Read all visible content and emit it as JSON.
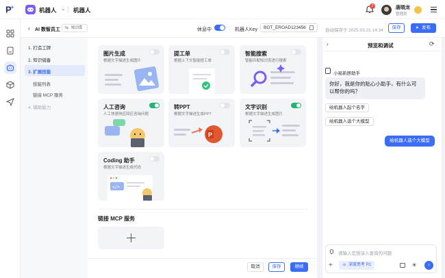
{
  "brand": {
    "logo_text": "P",
    "logo_sup": "+"
  },
  "header": {
    "robot_name": "机器人",
    "robot_name_secondary": "机器人",
    "notification_count": "2",
    "user_name": "唐晓龙",
    "user_role": "管理员"
  },
  "subheader": {
    "back_label": "AI 数智员工",
    "kb_label": "知识库",
    "rest_label": "休息中",
    "key_label": "机器人Key",
    "key_value": "BOT_EROAD123456",
    "autosave": "自动保存于 2025.03.21 14:34",
    "save_label": "保存",
    "publish_label": "发布"
  },
  "steps": [
    {
      "label": "1. 打造工牌"
    },
    {
      "label": "2. 知识储备"
    },
    {
      "label": "3. 扩展技能"
    },
    {
      "label": "技能列表"
    },
    {
      "label": "链接 MCP 服务"
    },
    {
      "label": "4. 辅助能力"
    }
  ],
  "skills": [
    {
      "title": "图片生成",
      "desc": "根据文字描述生成图片",
      "enabled": false
    },
    {
      "title": "提工单",
      "desc": "根据上下文智能提工单",
      "enabled": false
    },
    {
      "title": "智能搜索",
      "desc": "智能匹配知识库进行搜索",
      "enabled": false
    },
    {
      "title": "人工咨询",
      "desc": "人工快速响应回应咨询问题",
      "enabled": true
    },
    {
      "title": "转PPT",
      "desc": "根据文字描述生成PPT",
      "enabled": false
    },
    {
      "title": "文字识别",
      "desc": "根据文字描述生成图片",
      "enabled": true
    },
    {
      "title": "Coding 助手",
      "desc": "根据文字描述生成代码",
      "enabled": false
    }
  ],
  "mcp": {
    "title": "链接 MCP 服务"
  },
  "footer": {
    "cancel": "取消",
    "save": "保存",
    "next": "继续"
  },
  "preview": {
    "title": "预览和调试",
    "bot_name": "小易新居助手",
    "greeting": "你好，我是你的贴心小助手，有什么可以帮你的吗？",
    "suggestions": [
      "给机器人起个名字",
      "给机器人选个大模型"
    ],
    "user_message": "给机器人选个大模型",
    "input_placeholder": "请输入您想深入查询的问题",
    "think_chip": "深度思考 R1"
  },
  "colors": {
    "accent": "#3b6cf6",
    "toggle_on": "#22b573"
  }
}
